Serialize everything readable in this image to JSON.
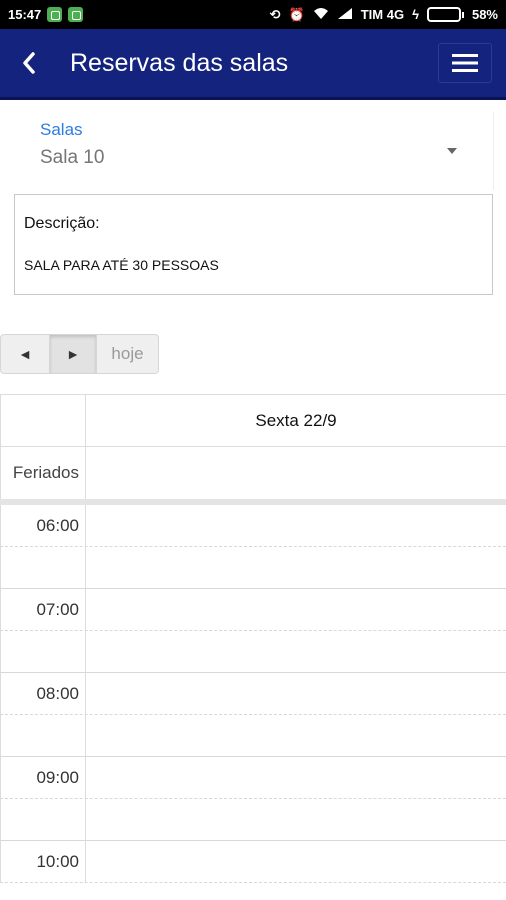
{
  "status_bar": {
    "time": "15:47",
    "carrier": "TIM 4G",
    "battery": "58%",
    "battery_level": 0.58
  },
  "header": {
    "title": "Reservas das salas",
    "back_icon": "chevron-left-icon",
    "menu_icon": "hamburger-menu-icon"
  },
  "room_select": {
    "label": "Salas",
    "value": "Sala 10"
  },
  "description": {
    "title": "Descrição:",
    "text": "SALA PARA ATÉ 30 PESSOAS"
  },
  "nav": {
    "prev": "◄",
    "next": "►",
    "today": "hoje"
  },
  "calendar": {
    "day_header": "Sexta 22/9",
    "allday_label": "Feriados",
    "hours": [
      "06:00",
      "07:00",
      "08:00",
      "09:00",
      "10:00"
    ]
  },
  "colors": {
    "header_bg": "#14237e",
    "accent": "#2b7de0"
  }
}
